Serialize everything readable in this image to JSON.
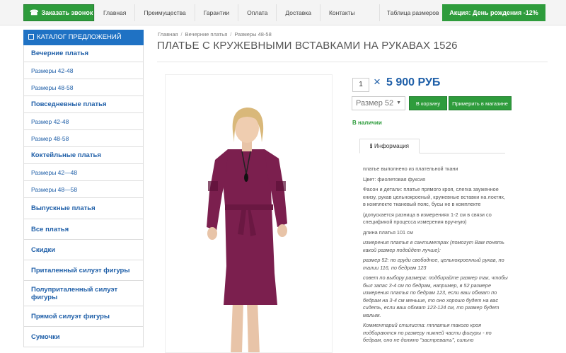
{
  "topbar": {
    "call_label": "Заказать звонок",
    "nav": [
      "Главная",
      "Преимущества",
      "Гарантии",
      "Оплата",
      "Доставка",
      "Контакты"
    ],
    "size_table": "Таблица размеров",
    "promo": "Акция: День рождения -12%"
  },
  "sidebar": {
    "header": "КАТАЛОГ ПРЕДЛОЖЕНИЙ",
    "items": [
      {
        "label": "Вечерние платья",
        "type": "main"
      },
      {
        "label": "Размеры 42-48",
        "type": "sub"
      },
      {
        "label": "Размеры 48-58",
        "type": "sub"
      },
      {
        "label": "Повседневные платья",
        "type": "main"
      },
      {
        "label": "Размер 42-48",
        "type": "sub"
      },
      {
        "label": "Размер 48-58",
        "type": "sub"
      },
      {
        "label": "Коктейльные платья",
        "type": "main"
      },
      {
        "label": "Размеры 42—48",
        "type": "sub"
      },
      {
        "label": "Размеры 48—58",
        "type": "sub"
      },
      {
        "label": "Выпускные платья",
        "type": "main"
      },
      {
        "label": "Все платья",
        "type": "main"
      },
      {
        "label": "Скидки",
        "type": "main"
      },
      {
        "label": "Приталенный силуэт фигуры",
        "type": "main"
      },
      {
        "label": "Полуприталенный силуэт фигуры",
        "type": "main"
      },
      {
        "label": "Прямой силуэт фигуры",
        "type": "main"
      },
      {
        "label": "Сумочки",
        "type": "main"
      }
    ]
  },
  "breadcrumb": [
    "Главная",
    "Вечерние платья",
    "Размеры 48-58"
  ],
  "product": {
    "title": "ПЛАТЬЕ С КРУЖЕВНЫМИ ВСТАВКАМИ НА РУКАВАХ 1526",
    "quantity": "1",
    "price_prefix": "×",
    "price": "5 900 РУБ",
    "size_selected": "Размер 52",
    "cart_button": "В корзину",
    "try_button": "Примерить в магазине",
    "availability": "В наличии",
    "tab_label": "Информация",
    "dress_color": "#7b1f4e"
  },
  "description": [
    {
      "text": "платье выполнено из плательной ткани",
      "italic": false
    },
    {
      "text": "Цвет: фиолетовая фуксия",
      "italic": false
    },
    {
      "text": "Фасон и детали: платье прямого кроя, слегка зауженное книзу, рукав цельнокроеный, кружевные вставки на локтях, в комплекте тканевый пояс, бусы не в комплекте",
      "italic": false
    },
    {
      "text": "(допускается разница в измерениях 1-2 см в связи со спецификой процесса измерения вручную)",
      "italic": false
    },
    {
      "text": "длина платья 101 см",
      "italic": false
    },
    {
      "text": "измерения платья в сантиметрах (помогут Вам понять какой размер подойдет лучше):",
      "italic": true
    },
    {
      "text": "размер 52: по груди свободное, цельнокроенный рукав, по талии 116, по бедрам 123",
      "italic": true
    },
    {
      "text": "совет по выбору размера: подбирайте размер так, чтобы был запас 3-4 см по бедрам, например, в 52 размере измерения платья по бедрам 123, если ваш обхват по бедрам на 3-4 см меньше, то оно хорошо будет на вас сидеть, если ваш обхват 123-124 см, то размер будет малым.",
      "italic": true
    },
    {
      "text": "Комментарий стилиста: тплатья такого кроя подбираются по размеру нижней части фигуры - по бедрам, оно не должно \"застревать\", сильно",
      "italic": true
    }
  ]
}
